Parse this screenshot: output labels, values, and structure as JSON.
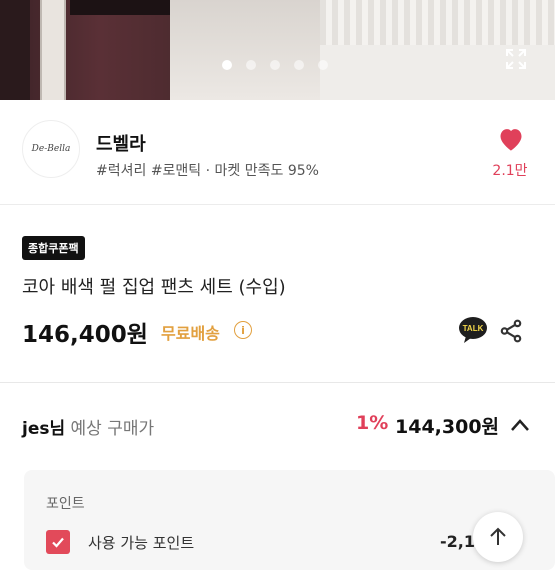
{
  "gallery": {
    "page_count": 5,
    "active_index": 0
  },
  "seller": {
    "logo_text": "De-Bella",
    "name": "드벨라",
    "tags": "#럭셔리 #로맨틱 · 마켓 만족도 95%",
    "like_count": "2.1만"
  },
  "product": {
    "badge": "종합쿠폰팩",
    "title": "코아 배색 펄 집업 팬츠 세트 (수입)",
    "price": "146,400원",
    "shipping": "무료배송",
    "info_symbol": "i",
    "talk_label": "TALK"
  },
  "estimate": {
    "user": "jes님",
    "label": "예상 구매가",
    "discount": "1%",
    "price": "144,300원"
  },
  "points": {
    "header": "포인트",
    "available_label": "사용 가능 포인트",
    "available_value": "-2,1"
  },
  "icons": {
    "expand": "expand-icon",
    "heart": "heart-icon",
    "talk": "kakao-talk-icon",
    "share": "share-icon",
    "chevron": "chevron-up-icon",
    "check": "check-icon",
    "scroll_top": "arrow-up-icon"
  },
  "colors": {
    "accent": "#e0405a",
    "shipping": "#e2a03f",
    "badge_bg": "#111111"
  }
}
